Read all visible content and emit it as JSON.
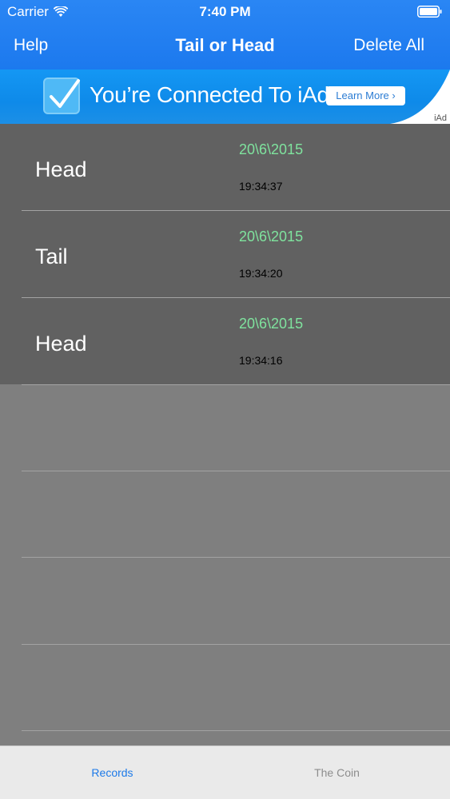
{
  "status_bar": {
    "carrier": "Carrier",
    "time": "7:40 PM"
  },
  "nav": {
    "left_label": "Help",
    "title": "Tail or Head",
    "right_label": "Delete All"
  },
  "ad": {
    "headline": "You’re Connected To iAd",
    "button_label": "Learn More ›",
    "badge": "iAd"
  },
  "records": [
    {
      "result": "Head",
      "date": "20\\6\\2015",
      "time": "19:34:37"
    },
    {
      "result": "Tail",
      "date": "20\\6\\2015",
      "time": "19:34:20"
    },
    {
      "result": "Head",
      "date": "20\\6\\2015",
      "time": "19:34:16"
    }
  ],
  "tabs": [
    {
      "label": "Records",
      "selected": true
    },
    {
      "label": "The Coin",
      "selected": false
    }
  ],
  "colors": {
    "nav_blue": "#1c79ee",
    "date_green": "#7fe39e",
    "row_fill": "#616161",
    "empty_fill": "#7f7f7f",
    "tab_active": "#1d7ae8"
  }
}
